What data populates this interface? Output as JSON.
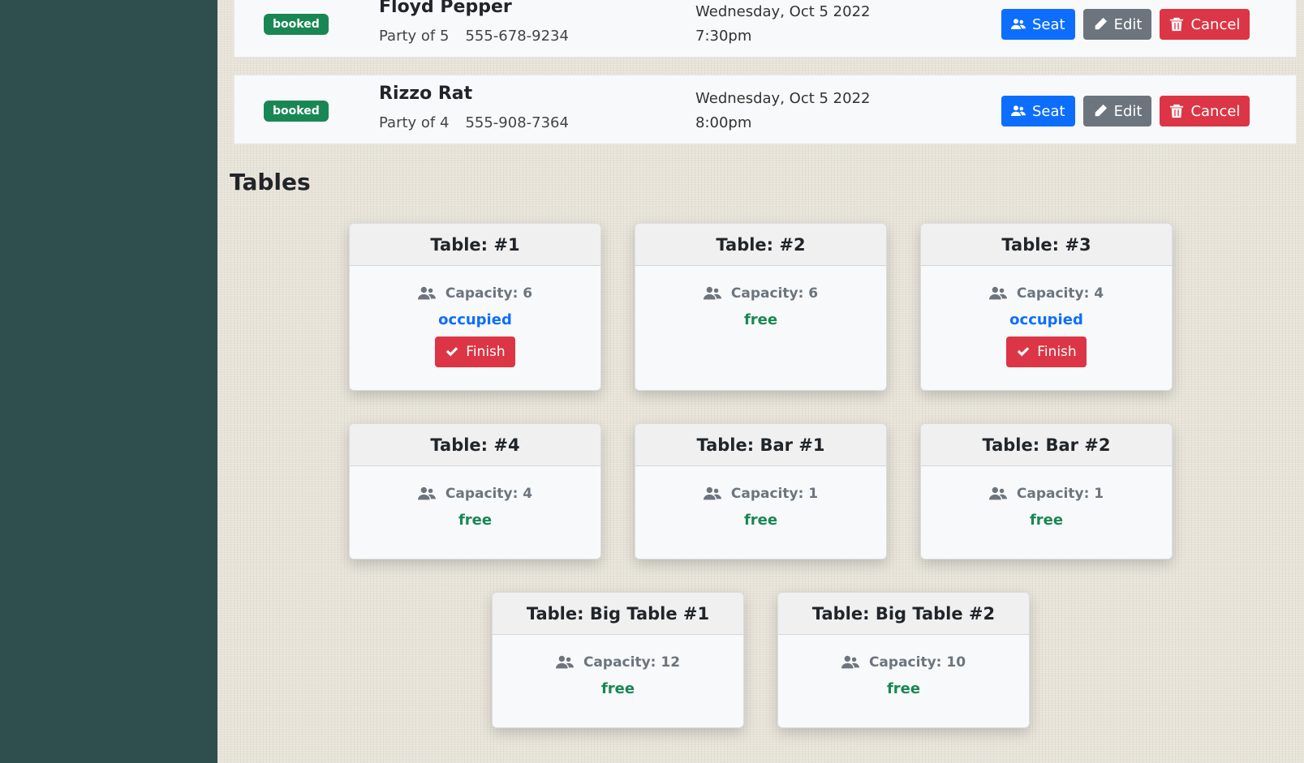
{
  "reservations": [
    {
      "status": "booked",
      "name": "Floyd Pepper",
      "party": "Party of 5",
      "phone": "555-678-9234",
      "date": "Wednesday, Oct 5 2022",
      "time": "7:30pm",
      "seat_label": "Seat",
      "edit_label": "Edit",
      "cancel_label": "Cancel"
    },
    {
      "status": "booked",
      "name": "Rizzo Rat",
      "party": "Party of 4",
      "phone": "555-908-7364",
      "date": "Wednesday, Oct 5 2022",
      "time": "8:00pm",
      "seat_label": "Seat",
      "edit_label": "Edit",
      "cancel_label": "Cancel"
    }
  ],
  "tables_heading": "Tables",
  "tables": [
    {
      "title": "Table: #1",
      "capacity": "Capacity: 6",
      "status": "occupied",
      "finish_label": "Finish"
    },
    {
      "title": "Table: #2",
      "capacity": "Capacity: 6",
      "status": "free"
    },
    {
      "title": "Table: #3",
      "capacity": "Capacity: 4",
      "status": "occupied",
      "finish_label": "Finish"
    },
    {
      "title": "Table: #4",
      "capacity": "Capacity: 4",
      "status": "free"
    },
    {
      "title": "Table: Bar #1",
      "capacity": "Capacity: 1",
      "status": "free"
    },
    {
      "title": "Table: Bar #2",
      "capacity": "Capacity: 1",
      "status": "free"
    },
    {
      "title": "Table: Big Table #1",
      "capacity": "Capacity: 12",
      "status": "free"
    },
    {
      "title": "Table: Big Table #2",
      "capacity": "Capacity: 10",
      "status": "free"
    }
  ],
  "colors": {
    "sidebar": "#2f4f4f",
    "primary": "#0d6efd",
    "secondary": "#6c757d",
    "danger": "#dc3545",
    "success": "#198754"
  }
}
